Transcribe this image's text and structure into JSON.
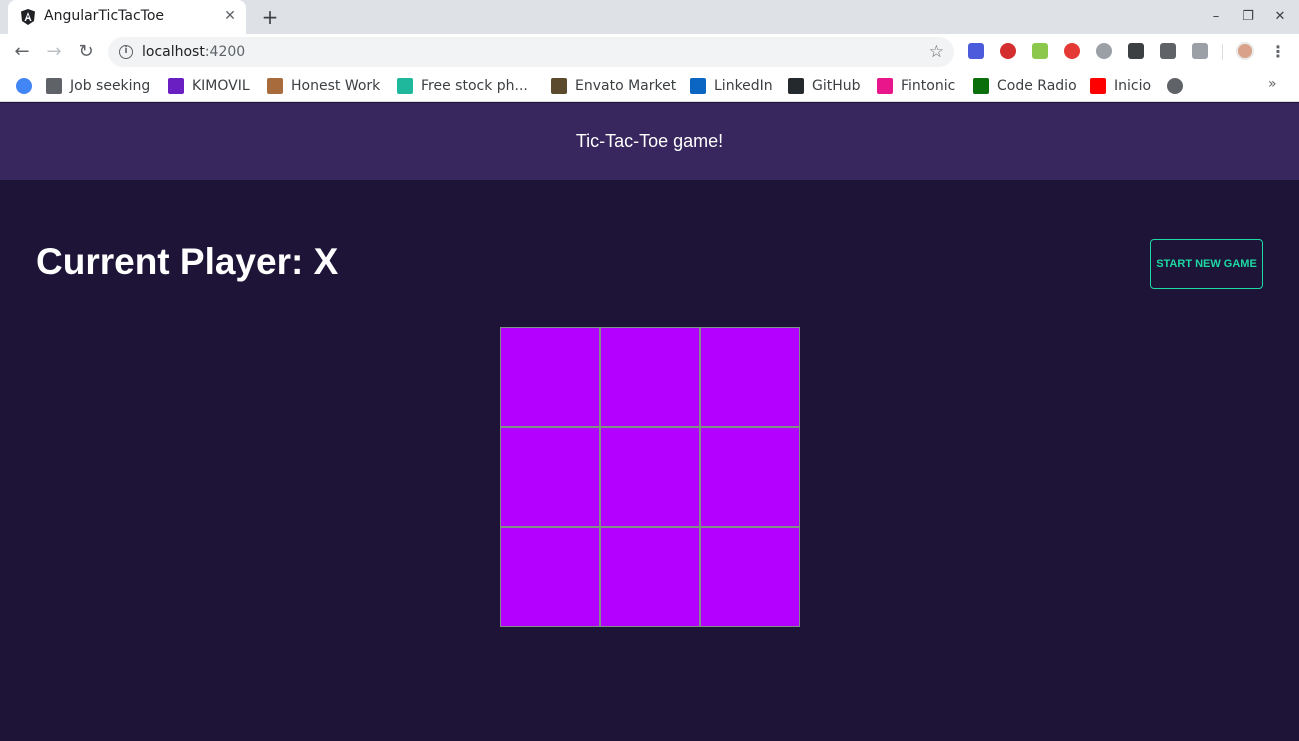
{
  "browser": {
    "tab": {
      "title": "AngularTicTacToe",
      "close_glyph": "✕",
      "favicon": "angular-logo-icon"
    },
    "new_tab_glyph": "+",
    "window_controls": {
      "minimize": "–",
      "restore": "❐",
      "close": "✕"
    },
    "nav": {
      "back": "←",
      "forward": "→",
      "reload": "↻"
    },
    "url": {
      "host": "localhost",
      "port": ":4200"
    },
    "bookmarks": [
      {
        "label": "",
        "icon": "google-icon",
        "color": "#4285f4"
      },
      {
        "label": "Job seeking",
        "icon": "folder-icon",
        "color": "#5f6368"
      },
      {
        "label": "KIMOVIL",
        "icon": "kimovil-icon",
        "color": "#6a1fc2"
      },
      {
        "label": "Honest Work",
        "icon": "dog-icon",
        "color": "#a86b3c"
      },
      {
        "label": "Free stock ph...",
        "icon": "stock-photo-icon",
        "color": "#1fb89c"
      },
      {
        "label": "Envato Market",
        "icon": "envato-icon",
        "color": "#5c4a2c"
      },
      {
        "label": "LinkedIn",
        "icon": "linkedin-icon",
        "color": "#0a66c2"
      },
      {
        "label": "GitHub",
        "icon": "github-icon",
        "color": "#24292e"
      },
      {
        "label": "Fintonic",
        "icon": "fintonic-icon",
        "color": "#e8168a"
      },
      {
        "label": "Code Radio",
        "icon": "code-radio-icon",
        "color": "#0a6e0a"
      },
      {
        "label": "Inicio",
        "icon": "youtube-icon",
        "color": "#ff0000"
      },
      {
        "label": "",
        "icon": "globe-icon",
        "color": "#5f6368"
      }
    ],
    "bookmarks_more": "»",
    "extensions": [
      {
        "name": "extension-1-icon",
        "color": "#4b5bdc"
      },
      {
        "name": "adblock-icon",
        "color": "#d32f2f"
      },
      {
        "name": "nodejs-icon",
        "color": "#8cc84b"
      },
      {
        "name": "stop-icon",
        "color": "#e53935"
      },
      {
        "name": "timer-icon",
        "color": "#9aa0a6"
      },
      {
        "name": "json-icon",
        "color": "#3c4043"
      },
      {
        "name": "eyedropper-icon",
        "color": "#5f6368"
      },
      {
        "name": "extension-8-icon",
        "color": "#9aa0a6"
      }
    ]
  },
  "app": {
    "header_title": "Tic-Tac-Toe game!",
    "current_player_label": "Current Player: X",
    "new_game_label": "START NEW GAME",
    "board": [
      "",
      "",
      "",
      "",
      "",
      "",
      "",
      "",
      ""
    ],
    "colors": {
      "header_bg": "#37275e",
      "page_bg": "#1d1438",
      "cell_bg": "#b300ff",
      "accent": "#1ed9a4"
    }
  }
}
